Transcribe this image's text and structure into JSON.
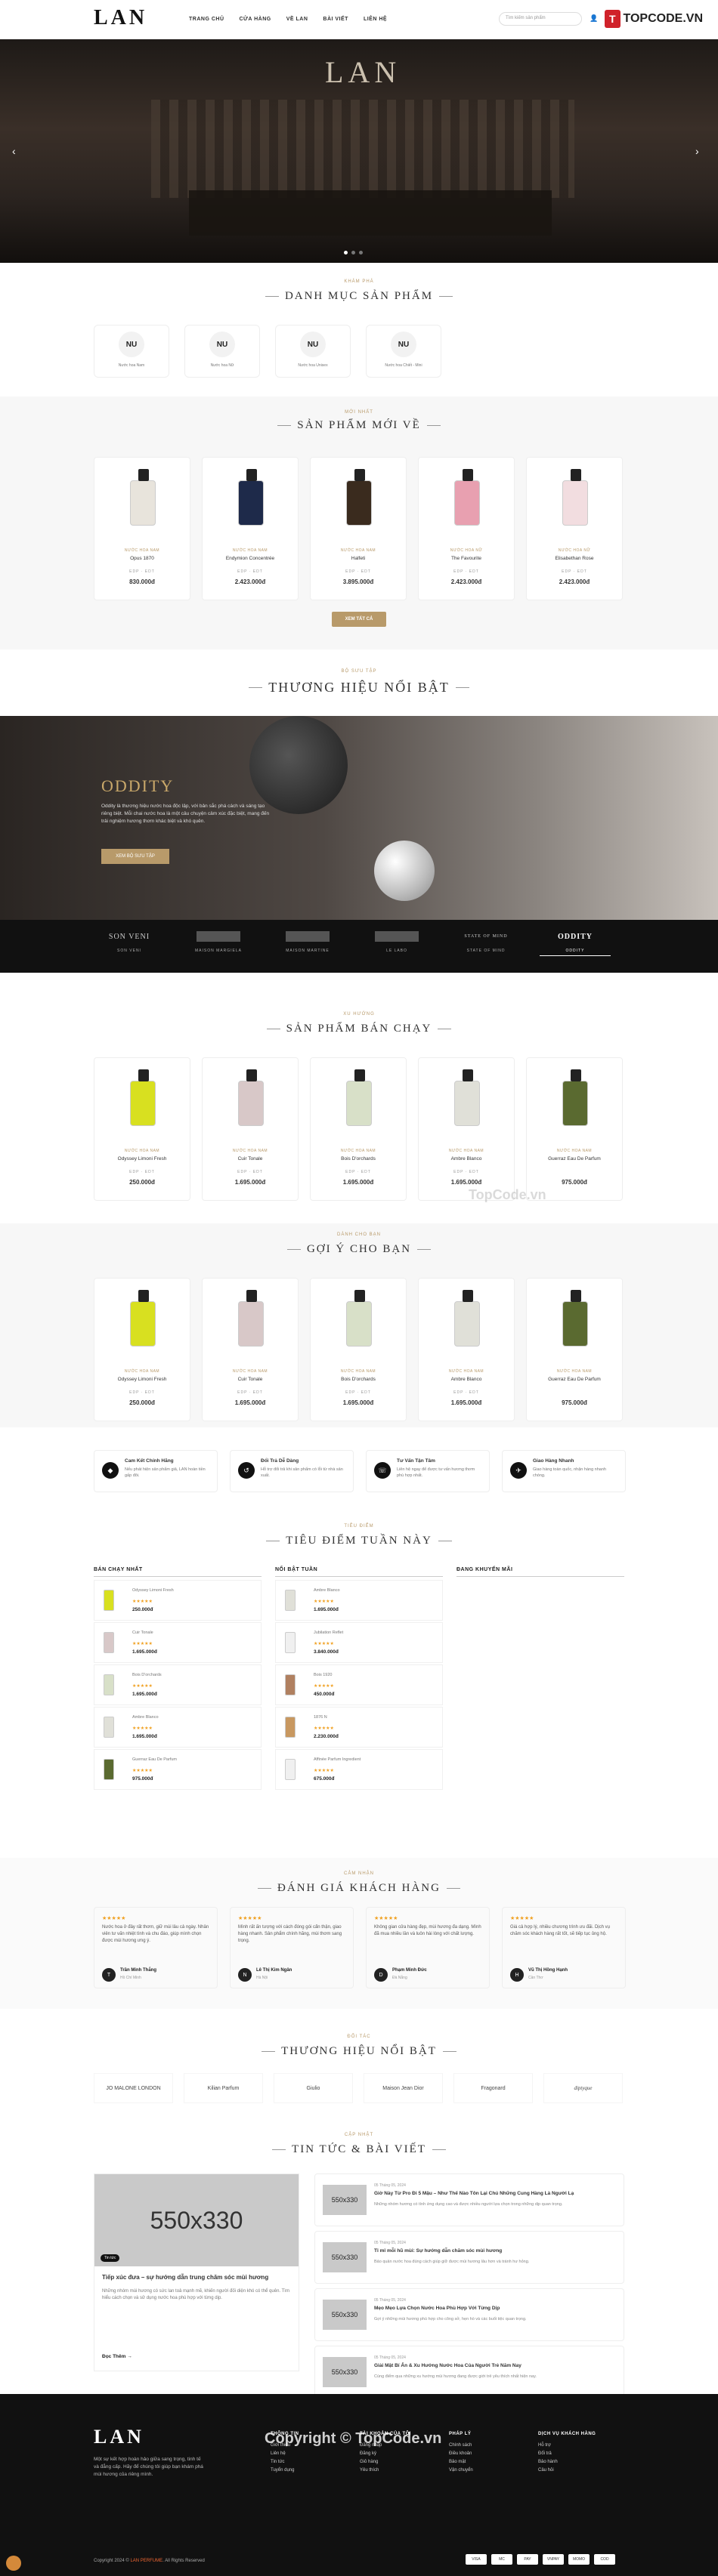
{
  "header": {
    "logo": "LAN",
    "nav": [
      "TRANG CHỦ",
      "CỬA HÀNG",
      "VỀ LAN",
      "BÀI VIẾT",
      "LIÊN HỆ"
    ],
    "search_placeholder": "Tìm kiếm sản phẩm",
    "topcode": "TOPCODE.VN"
  },
  "hero": {
    "logo": "LAN"
  },
  "categories": {
    "eyebrow": "KHÁM PHÁ",
    "title": "DANH MỤC SẢN PHẨM",
    "items": [
      {
        "icon": "NU",
        "label": "Nước hoa Nam"
      },
      {
        "icon": "NU",
        "label": "Nước hoa Nữ"
      },
      {
        "icon": "NU",
        "label": "Nước hoa Unisex"
      },
      {
        "icon": "NU",
        "label": "Nước hoa Chiết - Mini"
      }
    ]
  },
  "new_products": {
    "eyebrow": "MỚI NHẤT",
    "title": "SẢN PHẨM MỚI VỀ",
    "button": "XEM TẤT CẢ",
    "items": [
      {
        "brand": "NƯỚC HOA NAM",
        "name": "Opus 1870",
        "opts": "EDP · EDT",
        "price": "830.000đ",
        "color": "#e8e4dc"
      },
      {
        "brand": "NƯỚC HOA NAM",
        "name": "Endymion Concentrée",
        "opts": "EDP · EDT",
        "price": "2.423.000đ",
        "color": "#1e2a4a"
      },
      {
        "brand": "NƯỚC HOA NAM",
        "name": "Halfeti",
        "opts": "EDP · EDT",
        "price": "3.895.000đ",
        "color": "#3a2b1e"
      },
      {
        "brand": "NƯỚC HOA NỮ",
        "name": "The Favourite",
        "opts": "EDP · EDT",
        "price": "2.423.000đ",
        "color": "#e8a0b0"
      },
      {
        "brand": "NƯỚC HOA NỮ",
        "name": "Elisabethan Rose",
        "opts": "EDP · EDT",
        "price": "2.423.000đ",
        "color": "#f2dde0"
      }
    ]
  },
  "featured_brand": {
    "eyebrow": "BỘ SƯU TẬP",
    "title": "THƯƠNG HIỆU NỔI BẬT",
    "brand": "ODDITY",
    "text": "Oddity là thương hiệu nước hoa độc lập, với bản sắc phá cách và sáng tạo riêng biệt. Mỗi chai nước hoa là một câu chuyện cảm xúc đặc biệt, mang đến trải nghiệm hương thơm khác biệt và khó quên.",
    "button": "XEM BỘ SƯU TẬP",
    "strip": [
      {
        "logo": "SON VENI",
        "name": "SON VENI"
      },
      {
        "logo": "",
        "name": "MAISON MARGIELA"
      },
      {
        "logo": "",
        "name": "MAISON MARTINE"
      },
      {
        "logo": "",
        "name": "LE LABO"
      },
      {
        "logo": "STATE OF MIND",
        "name": "STATE OF MIND"
      },
      {
        "logo": "ODDITY",
        "name": "ODDITY"
      }
    ]
  },
  "bestsellers": {
    "eyebrow": "XU HƯỚNG",
    "title": "SẢN PHẨM BÁN CHẠY",
    "items": [
      {
        "brand": "NƯỚC HOA NAM",
        "name": "Odyssey Limoni Fresh",
        "opts": "EDP · EDT",
        "price": "250.000đ",
        "color": "#d8e020"
      },
      {
        "brand": "NƯỚC HOA NAM",
        "name": "Cuir Tonale",
        "opts": "EDP · EDT",
        "price": "1.695.000đ",
        "color": "#d8c8c8"
      },
      {
        "brand": "NƯỚC HOA NAM",
        "name": "Bois D'orchards",
        "opts": "EDP · EDT",
        "price": "1.695.000đ",
        "color": "#d8e0c8"
      },
      {
        "brand": "NƯỚC HOA NAM",
        "name": "Ambre Blanco",
        "opts": "EDP · EDT",
        "price": "1.695.000đ",
        "color": "#e0e0d8"
      },
      {
        "brand": "NƯỚC HOA NAM",
        "name": "Guerraz Eau De Parfum",
        "opts": "",
        "price": "975.000đ",
        "color": "#5a6a30"
      }
    ]
  },
  "suggested": {
    "eyebrow": "DÀNH CHO BẠN",
    "title": "GỢI Ý CHO BẠN",
    "items": [
      {
        "brand": "NƯỚC HOA NAM",
        "name": "Odyssey Limoni Fresh",
        "opts": "EDP · EDT",
        "price": "250.000đ",
        "color": "#d8e020"
      },
      {
        "brand": "NƯỚC HOA NAM",
        "name": "Cuir Tonale",
        "opts": "EDP · EDT",
        "price": "1.695.000đ",
        "color": "#d8c8c8"
      },
      {
        "brand": "NƯỚC HOA NAM",
        "name": "Bois D'orchards",
        "opts": "EDP · EDT",
        "price": "1.695.000đ",
        "color": "#d8e0c8"
      },
      {
        "brand": "NƯỚC HOA NAM",
        "name": "Ambre Blanco",
        "opts": "EDP · EDT",
        "price": "1.695.000đ",
        "color": "#e0e0d8"
      },
      {
        "brand": "NƯỚC HOA NAM",
        "name": "Guerraz Eau De Parfum",
        "opts": "",
        "price": "975.000đ",
        "color": "#5a6a30"
      }
    ]
  },
  "services": [
    {
      "icon": "◆",
      "title": "Cam Kết Chính Hãng",
      "desc": "Nếu phát hiện sản phẩm giả, LAN hoàn tiền gấp đôi."
    },
    {
      "icon": "↺",
      "title": "Đổi Trả Dễ Dàng",
      "desc": "Hỗ trợ đổi trả khi sản phẩm có lỗi từ nhà sản xuất."
    },
    {
      "icon": "☏",
      "title": "Tư Vấn Tận Tâm",
      "desc": "Liên hệ ngay để được tư vấn hương thơm phù hợp nhất."
    },
    {
      "icon": "✈",
      "title": "Giao Hàng Nhanh",
      "desc": "Giao hàng toàn quốc, nhận hàng nhanh chóng."
    }
  ],
  "weekly": {
    "eyebrow": "TIÊU ĐIỂM",
    "title": "TIÊU ĐIỂM TUẦN NÀY",
    "cols": [
      {
        "head": "BÁN CHẠY NHẤT",
        "items": [
          {
            "name": "Odyssey Limoni Fresh",
            "stars": "★★★★★",
            "price": "250.000đ",
            "color": "#d8e020"
          },
          {
            "name": "Cuir Tonale",
            "stars": "★★★★★",
            "price": "1.695.000đ",
            "color": "#d8c8c8"
          },
          {
            "name": "Bois D'orchards",
            "stars": "★★★★★",
            "price": "1.695.000đ",
            "color": "#d8e0c8"
          },
          {
            "name": "Ambre Blanco",
            "stars": "★★★★★",
            "price": "1.695.000đ",
            "color": "#e0e0d8"
          },
          {
            "name": "Guerraz Eau De Parfum",
            "stars": "★★★★★",
            "price": "975.000đ",
            "color": "#5a6a30"
          }
        ]
      },
      {
        "head": "NỔI BẬT TUẦN",
        "items": [
          {
            "name": "Ambre Blanco",
            "stars": "★★★★★",
            "price": "1.695.000đ",
            "color": "#e0e0d8"
          },
          {
            "name": "Jubilation Reflet",
            "stars": "★★★★★",
            "price": "3.840.000đ",
            "color": "#f0f0f0"
          },
          {
            "name": "Bois 1920",
            "stars": "★★★★★",
            "price": "450.000đ",
            "color": "#b08060"
          },
          {
            "name": "1876 N",
            "stars": "★★★★★",
            "price": "2.230.000đ",
            "color": "#c89860"
          },
          {
            "name": "Affinée Parfum Ingredient",
            "stars": "★★★★★",
            "price": "675.000đ",
            "color": "#f0f0f0"
          }
        ]
      },
      {
        "head": "ĐANG KHUYẾN MÃI",
        "items": []
      }
    ]
  },
  "reviews": {
    "eyebrow": "CẢM NHẬN",
    "title": "ĐÁNH GIÁ KHÁCH HÀNG",
    "items": [
      {
        "stars": "★★★★★",
        "text": "Nước hoa ở đây rất thơm, giữ mùi lâu cả ngày. Nhân viên tư vấn nhiệt tình và chu đáo, giúp mình chọn được mùi hương ưng ý.",
        "initial": "T",
        "name": "Trần Minh Thắng",
        "loc": "Hồ Chí Minh"
      },
      {
        "stars": "★★★★★",
        "text": "Mình rất ấn tượng với cách đóng gói cẩn thận, giao hàng nhanh. Sản phẩm chính hãng, mùi thơm sang trọng.",
        "initial": "N",
        "name": "Lê Thị Kim Ngân",
        "loc": "Hà Nội"
      },
      {
        "stars": "★★★★★",
        "text": "Không gian cửa hàng đẹp, mùi hương đa dạng. Mình đã mua nhiều lần và luôn hài lòng với chất lượng.",
        "initial": "D",
        "name": "Phạm Minh Đức",
        "loc": "Đà Nẵng"
      },
      {
        "stars": "★★★★★",
        "text": "Giá cả hợp lý, nhiều chương trình ưu đãi. Dịch vụ chăm sóc khách hàng rất tốt, sẽ tiếp tục ủng hộ.",
        "initial": "H",
        "name": "Vũ Thị Hồng Hạnh",
        "loc": "Cần Thơ"
      }
    ]
  },
  "partners": {
    "eyebrow": "ĐỐI TÁC",
    "title": "THƯƠNG HIỆU NỔI BẬT",
    "items": [
      "JO MALONE LONDON",
      "Kilian Parfum",
      "Giulio",
      "Maison Jean Dior",
      "Fragonard",
      "diptyque"
    ]
  },
  "news": {
    "eyebrow": "CẬP NHẬT",
    "title": "TIN TỨC & BÀI VIẾT",
    "big": {
      "img": "550x330",
      "tag": "Tin tức",
      "title": "Tiếp xúc đưa – sự hướng dẫn trung chăm sóc mùi hương",
      "text": "Những nhóm mùi hương có sức lan toả mạnh mẽ, khiến người đối diện khó có thể quên. Tìm hiểu cách chọn và sử dụng nước hoa phù hợp với từng dịp.",
      "more": "Đọc Thêm →"
    },
    "items": [
      {
        "img": "550x330",
        "date": "05 Tháng 05, 2024",
        "title": "Giờ Này Từ Pro Đi 5 Mậu – Như Thế Nào Tôn Lại Chú Những Cung Hàng Là Người Lạ",
        "text": "Những nhóm hương có tính ứng dụng cao và được nhiều người lựa chọn trong những dịp quan trọng."
      },
      {
        "img": "550x330",
        "date": "05 Tháng 05, 2024",
        "title": "Tỉ mỉ mỗi hũ mùi: Sự hướng dẫn chăm sóc mùi hương",
        "text": "Bảo quản nước hoa đúng cách giúp giữ được mùi hương lâu hơn và tránh hư hỏng."
      },
      {
        "img": "550x330",
        "date": "05 Tháng 05, 2024",
        "title": "Mẹo Mẹo Lựa Chọn Nước Hoa Phù Hợp Với Từng Dịp",
        "text": "Gợi ý những mùi hương phù hợp cho công sở, hẹn hò và các buổi tiệc quan trọng."
      },
      {
        "img": "550x330",
        "date": "05 Tháng 05, 2024",
        "title": "Giải Mật Bí Ẩn & Xu Hướng Nước Hoa Của Người Trẻ Năm Nay",
        "text": "Cùng điểm qua những xu hướng mùi hương đang được giới trẻ yêu thích nhất hiện nay."
      }
    ]
  },
  "footer": {
    "logo": "LAN",
    "desc": "Một sự kết hợp hoàn hảo giữa sang trọng, tinh tế và đẳng cấp. Hãy để chúng tôi giúp bạn khám phá mùi hương của riêng mình.",
    "cols": [
      {
        "head": "THÔNG TIN",
        "items": [
          "Giới thiệu",
          "Liên hệ",
          "Tin tức",
          "Tuyển dụng"
        ]
      },
      {
        "head": "TÀI KHOẢN CỦA TÔI",
        "items": [
          "Đăng nhập",
          "Đăng ký",
          "Giỏ hàng",
          "Yêu thích"
        ]
      },
      {
        "head": "PHÁP LÝ",
        "items": [
          "Chính sách",
          "Điều khoản",
          "Bảo mật",
          "Vận chuyển"
        ]
      },
      {
        "head": "DỊCH VỤ KHÁCH HÀNG",
        "items": [
          "Hỗ trợ",
          "Đổi trả",
          "Bảo hành",
          "Câu hỏi"
        ]
      }
    ],
    "copyright_prefix": "Copyright 2024 © ",
    "copyright_brand": "LAN PERFUME",
    "copyright_suffix": ". All Rights Reserved",
    "payments": [
      "VISA",
      "MC",
      "PAY",
      "VNPAY",
      "MOMO",
      "COD"
    ]
  },
  "watermarks": {
    "bottom": "Copyright © TopCode.vn",
    "mid": "TopCode.vn"
  }
}
